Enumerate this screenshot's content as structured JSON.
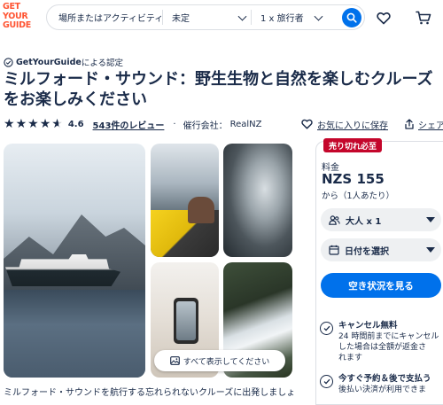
{
  "header": {
    "logo_lines": [
      "GET",
      "YOUR",
      "GUIDE"
    ],
    "search": {
      "where_placeholder": "場所またはアクティビティ...",
      "date_value": "未定",
      "travelers_value": "1 x 旅行者"
    }
  },
  "badge": {
    "brand": "GetYourGuide",
    "suffix": "による認定"
  },
  "title_lines": [
    "ミルフォード・サウンド：野生生物と自然を楽しむクルーズ",
    "をお楽しみください"
  ],
  "rating": {
    "stars_filled": 4.6,
    "stars_total": 5,
    "value": "4.6",
    "reviews_label": "543件のレビュー",
    "operator_label": "催行会社：",
    "operator_name": "RealNZ"
  },
  "actions": {
    "wishlist_label": "お気に入りに保存",
    "share_label": "シェア"
  },
  "gallery": {
    "show_all_label": "すべて表示してください"
  },
  "description": "ミルフォード・サウンドを航行する忘れられないクルーズに出発しましょう。",
  "booking": {
    "badge": "売り切れ必至",
    "price_label": "料金",
    "price": "NZS 155",
    "per_person": "から（1人あたり）",
    "participants": "大人 x 1",
    "date_select": "日付を選択",
    "availability_button": "空き状況を見る",
    "perks": [
      {
        "title": "キャンセル無料",
        "lines": [
          "24 時間前までにキャンセル",
          "した場合は全額が返金さ",
          "れます"
        ]
      },
      {
        "title": "今すぐ予約＆後で支払う",
        "lines": [
          "後払い決済が利用できま"
        ]
      }
    ]
  },
  "colors": {
    "brand_orange": "#ff5533",
    "primary_blue": "#0071eb",
    "badge_red": "#c4062b",
    "text_navy": "#1a2b49"
  }
}
